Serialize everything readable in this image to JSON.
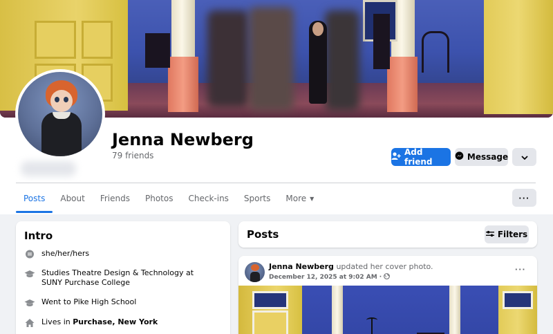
{
  "profile": {
    "name": "Jenna Newberg",
    "friends": "79 friends"
  },
  "actions": {
    "add_friend": "Add friend",
    "message": "Message"
  },
  "tabs": [
    {
      "label": "Posts",
      "active": true
    },
    {
      "label": "About"
    },
    {
      "label": "Friends"
    },
    {
      "label": "Photos"
    },
    {
      "label": "Check-ins"
    },
    {
      "label": "Sports"
    },
    {
      "label": "More"
    }
  ],
  "intro": {
    "title": "Intro",
    "pronouns": "she/her/hers",
    "studies": "Studies Theatre Design & Technology at SUNY Purchase College",
    "school": "Went to Pike High School",
    "lives_prefix": "Lives in ",
    "lives_place": "Purchase, New York"
  },
  "posts_section": {
    "title": "Posts",
    "filters": "Filters"
  },
  "post": {
    "author": "Jenna Newberg",
    "action": "updated her cover photo.",
    "date": "December 12, 2025 at 9:02 AM",
    "privacy_icon": "globe-icon"
  },
  "colors": {
    "accent": "#1b74e4",
    "page_bg": "#f0f2f5",
    "secondary_btn": "#e4e6eb",
    "muted_text": "#65676b"
  }
}
